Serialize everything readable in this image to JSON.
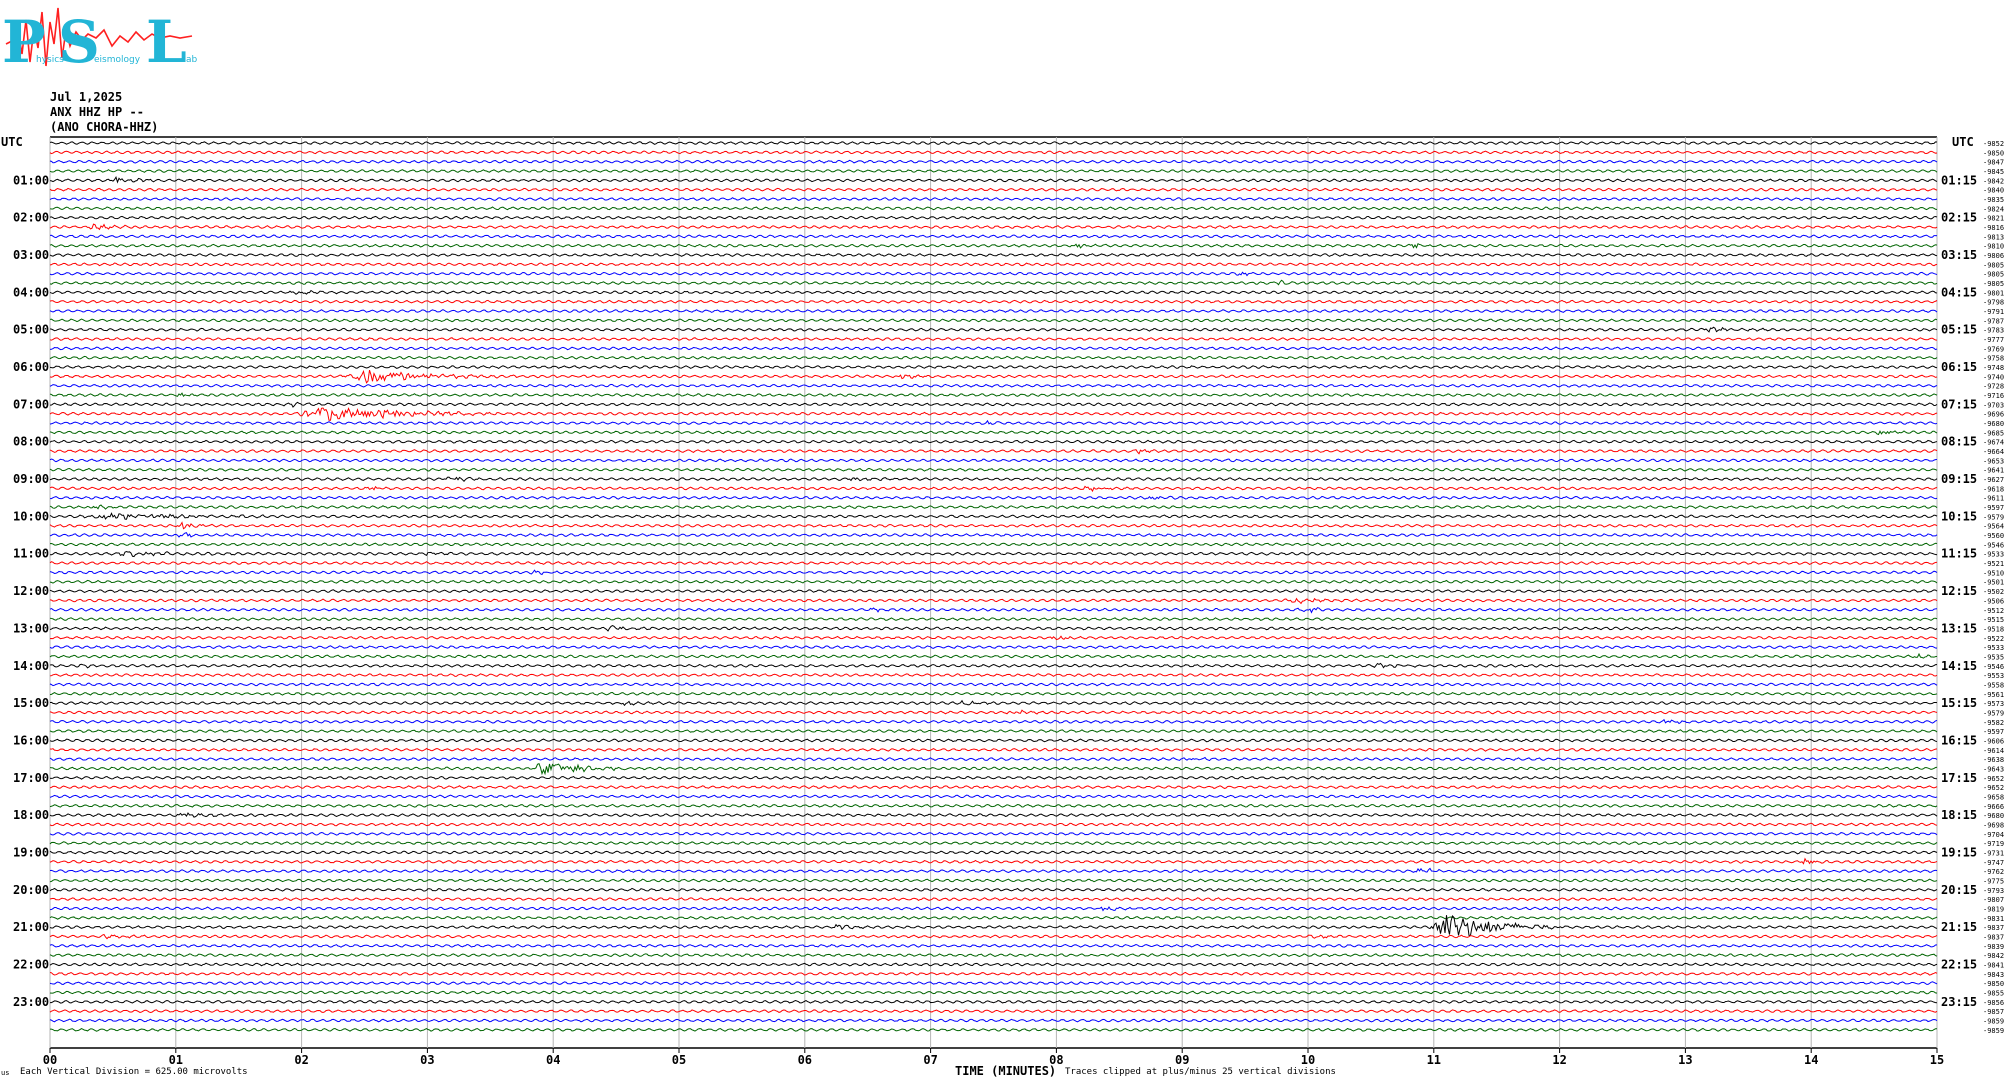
{
  "header": {
    "logo_letters": [
      "P",
      "S",
      "L"
    ],
    "logo_small_words": [
      "hysics",
      "eismology",
      "ab"
    ],
    "date": "Jul 1,2025",
    "station": "ANX HHZ HP --",
    "location": "(ANO CHORA-HHZ)"
  },
  "colors": {
    "trace_cycle": [
      "#000000",
      "#ff0000",
      "#0000ff",
      "#006400"
    ],
    "logo_cyan": "#22b5d6",
    "grid": "#b4b4b4"
  },
  "footer": {
    "left_mark": "us",
    "scale_note": "Each Vertical Division =  625.00 microvolts",
    "xlabel": "TIME (MINUTES)",
    "clip_note": "Traces clipped at plus/minus 25 vertical divisions"
  },
  "chart_data": {
    "type": "line",
    "title": "",
    "xlabel": "TIME (MINUTES)",
    "ylabel": "",
    "left_axis_label": "UTC",
    "right_axis_label": "UTC",
    "xlim": [
      0,
      15
    ],
    "x_ticks": [
      "00",
      "01",
      "02",
      "03",
      "04",
      "05",
      "06",
      "07",
      "08",
      "09",
      "10",
      "11",
      "12",
      "13",
      "14",
      "15"
    ],
    "trace_count": 96,
    "left_hour_labels": [
      "01:00",
      "02:00",
      "03:00",
      "04:00",
      "05:00",
      "06:00",
      "07:00",
      "08:00",
      "09:00",
      "10:00",
      "11:00",
      "12:00",
      "13:00",
      "14:00",
      "15:00",
      "16:00",
      "17:00",
      "18:00",
      "19:00",
      "20:00",
      "21:00",
      "22:00",
      "23:00"
    ],
    "right_hour_labels": [
      "01:15",
      "02:15",
      "03:15",
      "04:15",
      "05:15",
      "06:15",
      "07:15",
      "08:15",
      "09:15",
      "10:15",
      "11:15",
      "12:15",
      "13:15",
      "14:15",
      "15:15",
      "16:15",
      "17:15",
      "18:15",
      "19:15",
      "20:15",
      "21:15",
      "22:15",
      "23:15"
    ],
    "trace_offsets": [
      "-9852",
      "-9850",
      "-9847",
      "-9845",
      "-9842",
      "-9840",
      "-9835",
      "-9824",
      "-9821",
      "-9816",
      "-9813",
      "-9810",
      "-9806",
      "-9805",
      "-9805",
      "-9805",
      "-9801",
      "-9798",
      "-9791",
      "-9787",
      "-9783",
      "-9777",
      "-9769",
      "-9758",
      "-9748",
      "-9740",
      "-9728",
      "-9716",
      "-9703",
      "-9696",
      "-9680",
      "-9685",
      "-9674",
      "-9664",
      "-9653",
      "-9641",
      "-9627",
      "-9618",
      "-9611",
      "-9597",
      "-9579",
      "-9564",
      "-9560",
      "-9546",
      "-9533",
      "-9521",
      "-9510",
      "-9501",
      "-9502",
      "-9506",
      "-9512",
      "-9515",
      "-9518",
      "-9522",
      "-9533",
      "-9535",
      "-9546",
      "-9553",
      "-9558",
      "-9561",
      "-9573",
      "-9579",
      "-9582",
      "-9597",
      "-9606",
      "-9614",
      "-9638",
      "-9643",
      "-9652",
      "-9652",
      "-9658",
      "-9666",
      "-9680",
      "-9698",
      "-9704",
      "-9719",
      "-9731",
      "-9747",
      "-9762",
      "-9775",
      "-9793",
      "-9807",
      "-9819",
      "-9831",
      "-9837",
      "-9837",
      "-9839",
      "-9842",
      "-9841",
      "-9843",
      "-9850",
      "-9855",
      "-9856",
      "-9857",
      "-9859",
      "-9859"
    ],
    "events": [
      {
        "trace": 4,
        "minute": 0.45,
        "amp": 3.0,
        "dur": 0.5
      },
      {
        "trace": 9,
        "minute": 0.3,
        "amp": 4.5,
        "dur": 0.4
      },
      {
        "trace": 11,
        "minute": 8.1,
        "amp": 2.0,
        "dur": 0.4
      },
      {
        "trace": 11,
        "minute": 10.8,
        "amp": 2.0,
        "dur": 0.3
      },
      {
        "trace": 14,
        "minute": 9.4,
        "amp": 2.0,
        "dur": 0.4
      },
      {
        "trace": 15,
        "minute": 9.7,
        "amp": 2.0,
        "dur": 0.4
      },
      {
        "trace": 16,
        "minute": 1.9,
        "amp": 2.5,
        "dur": 0.4
      },
      {
        "trace": 20,
        "minute": 13.1,
        "amp": 2.5,
        "dur": 0.6
      },
      {
        "trace": 25,
        "minute": 2.3,
        "amp": 6.5,
        "dur": 1.4
      },
      {
        "trace": 25,
        "minute": 6.7,
        "amp": 2.0,
        "dur": 0.4
      },
      {
        "trace": 27,
        "minute": 1.0,
        "amp": 2.0,
        "dur": 0.3
      },
      {
        "trace": 28,
        "minute": 1.85,
        "amp": 2.5,
        "dur": 0.3
      },
      {
        "trace": 29,
        "minute": 1.95,
        "amp": 7.5,
        "dur": 1.7
      },
      {
        "trace": 30,
        "minute": 7.4,
        "amp": 2.0,
        "dur": 0.4
      },
      {
        "trace": 31,
        "minute": 14.5,
        "amp": 2.5,
        "dur": 0.4
      },
      {
        "trace": 33,
        "minute": 8.6,
        "amp": 2.0,
        "dur": 0.3
      },
      {
        "trace": 34,
        "minute": 9.2,
        "amp": 2.0,
        "dur": 0.4
      },
      {
        "trace": 36,
        "minute": 3.1,
        "amp": 2.5,
        "dur": 0.5
      },
      {
        "trace": 36,
        "minute": 6.3,
        "amp": 2.5,
        "dur": 0.5
      },
      {
        "trace": 37,
        "minute": 8.2,
        "amp": 3.5,
        "dur": 0.4
      },
      {
        "trace": 37,
        "minute": 2.5,
        "amp": 2.0,
        "dur": 0.3
      },
      {
        "trace": 38,
        "minute": 8.7,
        "amp": 2.0,
        "dur": 0.4
      },
      {
        "trace": 39,
        "minute": 0.3,
        "amp": 3.0,
        "dur": 0.3
      },
      {
        "trace": 40,
        "minute": 0.2,
        "amp": 2.5,
        "dur": 2.0
      },
      {
        "trace": 41,
        "minute": 1.0,
        "amp": 3.0,
        "dur": 0.4
      },
      {
        "trace": 42,
        "minute": 1.0,
        "amp": 2.5,
        "dur": 0.3
      },
      {
        "trace": 44,
        "minute": 0.5,
        "amp": 2.5,
        "dur": 1.0
      },
      {
        "trace": 44,
        "minute": 2.9,
        "amp": 2.0,
        "dur": 0.4
      },
      {
        "trace": 46,
        "minute": 3.8,
        "amp": 2.0,
        "dur": 0.4
      },
      {
        "trace": 49,
        "minute": 9.8,
        "amp": 2.5,
        "dur": 0.6
      },
      {
        "trace": 50,
        "minute": 6.5,
        "amp": 2.0,
        "dur": 0.3
      },
      {
        "trace": 50,
        "minute": 9.9,
        "amp": 3.5,
        "dur": 0.4
      },
      {
        "trace": 52,
        "minute": 4.4,
        "amp": 2.5,
        "dur": 0.4
      },
      {
        "trace": 53,
        "minute": 7.95,
        "amp": 2.5,
        "dur": 0.3
      },
      {
        "trace": 55,
        "minute": 14.8,
        "amp": 2.0,
        "dur": 0.3
      },
      {
        "trace": 56,
        "minute": 0.2,
        "amp": 2.0,
        "dur": 0.3
      },
      {
        "trace": 56,
        "minute": 10.5,
        "amp": 2.0,
        "dur": 0.5
      },
      {
        "trace": 60,
        "minute": 4.5,
        "amp": 2.0,
        "dur": 0.4
      },
      {
        "trace": 60,
        "minute": 7.2,
        "amp": 2.0,
        "dur": 0.4
      },
      {
        "trace": 61,
        "minute": 7.6,
        "amp": 2.0,
        "dur": 0.4
      },
      {
        "trace": 62,
        "minute": 12.8,
        "amp": 2.0,
        "dur": 0.3
      },
      {
        "trace": 66,
        "minute": 9.0,
        "amp": 2.0,
        "dur": 0.3
      },
      {
        "trace": 67,
        "minute": 3.8,
        "amp": 6.5,
        "dur": 0.9
      },
      {
        "trace": 72,
        "minute": 1.0,
        "amp": 2.5,
        "dur": 0.5
      },
      {
        "trace": 77,
        "minute": 13.9,
        "amp": 3.0,
        "dur": 0.3
      },
      {
        "trace": 78,
        "minute": 10.85,
        "amp": 4.0,
        "dur": 0.3
      },
      {
        "trace": 82,
        "minute": 8.3,
        "amp": 2.0,
        "dur": 0.5
      },
      {
        "trace": 84,
        "minute": 6.2,
        "amp": 2.0,
        "dur": 0.4
      },
      {
        "trace": 84,
        "minute": 10.95,
        "amp": 14.0,
        "dur": 1.1
      },
      {
        "trace": 85,
        "minute": 0.4,
        "amp": 2.0,
        "dur": 0.4
      },
      {
        "trace": 85,
        "minute": 10.0,
        "amp": 2.0,
        "dur": 0.3
      }
    ]
  }
}
